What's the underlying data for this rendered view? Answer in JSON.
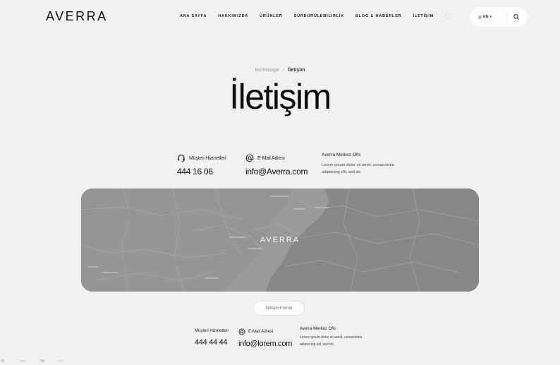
{
  "brand": {
    "logo_text": "AVERRA"
  },
  "nav": {
    "items": [
      {
        "label": "ANA SAYFA"
      },
      {
        "label": "HAKKIMIZDA"
      },
      {
        "label": "ÜRÜNLER"
      },
      {
        "label": "SÜRDÜRÜLEBİLİRLİK"
      },
      {
        "label": "BLOG & HABERLER"
      },
      {
        "label": "İLETİŞİM"
      }
    ]
  },
  "header_tools": {
    "language": "EN",
    "search_icon": "search-icon",
    "language_icon": "flag-icon"
  },
  "breadcrumb": {
    "home": "Homepage",
    "separator": "•",
    "current": "İletişim"
  },
  "page": {
    "title": "İletişim"
  },
  "contact": {
    "customer_service": {
      "label": "Müşteri Hizmetleri",
      "value": "444 16 06",
      "icon": "headset-icon"
    },
    "email": {
      "label": "E-Mail Adresi",
      "value": "info@Averra.com",
      "icon": "at-icon"
    },
    "office": {
      "title": "Averra Merkez Ofis",
      "address": "Lorem ipsum dolor sit amet, consectetur adipiscing elit, sed do"
    }
  },
  "map": {
    "logo_text": "AVERRA"
  },
  "form_button": {
    "label": "İletişim Formu"
  },
  "bottom_contact": {
    "customer_service": {
      "label": "Müşteri Hizmetleri",
      "value": "444 44 44"
    },
    "email": {
      "label": "E-Mail Adresi",
      "value": "info@lorem.com",
      "icon": "at-icon"
    },
    "office": {
      "title": "Averra Merkez Ofis",
      "address": "Lorem ipsum dolor sit amet, consectetur adipiscing elit, sed do."
    }
  },
  "colors": {
    "background": "#f1f1f1",
    "text": "#111111",
    "map": "#8d8d8d",
    "pill": "#ffffff"
  }
}
